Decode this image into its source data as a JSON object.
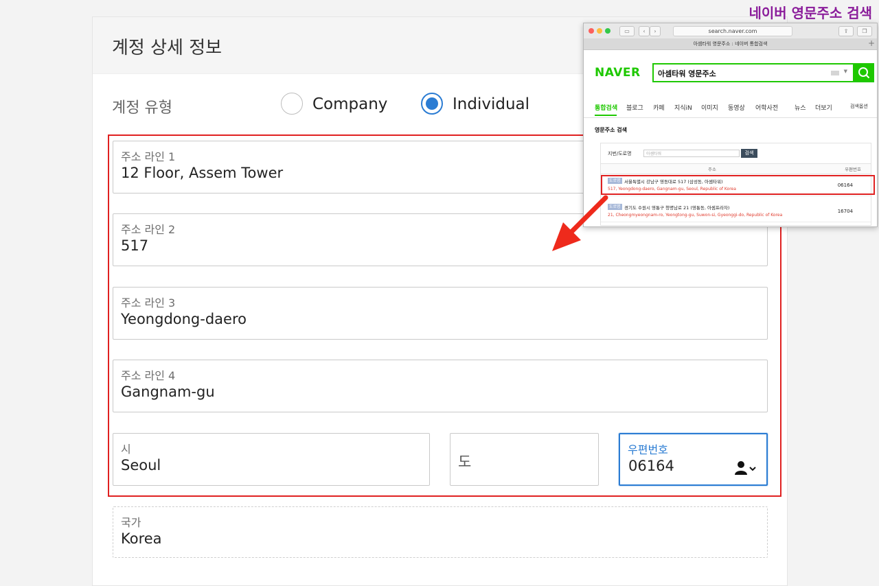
{
  "annotation": "네이버 영문주소 검색",
  "page": {
    "title": "계정 상세 정보",
    "account_type": {
      "label": "계정 유형",
      "options": [
        "Company",
        "Individual"
      ],
      "selected": "Individual"
    }
  },
  "fields": {
    "address1": {
      "label": "주소 라인 1",
      "value": "12 Floor, Assem Tower"
    },
    "address2": {
      "label": "주소 라인 2",
      "value": "517"
    },
    "address3": {
      "label": "주소 라인 3",
      "value": "Yeongdong-daero"
    },
    "address4": {
      "label": "주소 라인 4",
      "value": "Gangnam-gu"
    },
    "city": {
      "label": "시",
      "value": "Seoul"
    },
    "province": {
      "label": "도",
      "value": ""
    },
    "postal": {
      "label": "우편번호",
      "value": "06164"
    },
    "country": {
      "label": "국가",
      "value": "Korea"
    }
  },
  "browser": {
    "url": "search.naver.com",
    "tab_title": "아셈타워 영문주소 : 네이버 통합검색",
    "logo": "NAVER",
    "query": "아셈타워 영문주소",
    "nav": [
      "통합검색",
      "블로그",
      "카페",
      "지식iN",
      "이미지",
      "동영상",
      "어학사전",
      "뉴스",
      "더보기",
      "검색옵션"
    ],
    "section_title": "영문주소 검색",
    "filter_label": "지번/도로명",
    "filter_placeholder": "아셈타워",
    "filter_button": "검색",
    "col_address": "주소",
    "col_zip": "우편번호",
    "rows": [
      {
        "tag": "도로명",
        "kr": "서울특별시 강남구 영동대로 517 (삼성동, 아셈타워)",
        "en": "517, Yeongdong-daero, Gangnam-gu, Seoul, Republic of Korea",
        "zip": "06164"
      },
      {
        "tag": "도로명",
        "kr": "경기도 수원시 영통구 청명남로 21 (영통동, 아셈프라자)",
        "en": "21, Cheongmyeongnam-ro, Yeongtong-gu, Suwon-si, Gyeonggi-do, Republic of Korea",
        "zip": "16704"
      }
    ]
  },
  "colors": {
    "accent": "#2b7cd3",
    "highlight": "#e02020",
    "naver_green": "#1ec800",
    "annotation": "#8a1c9a"
  }
}
